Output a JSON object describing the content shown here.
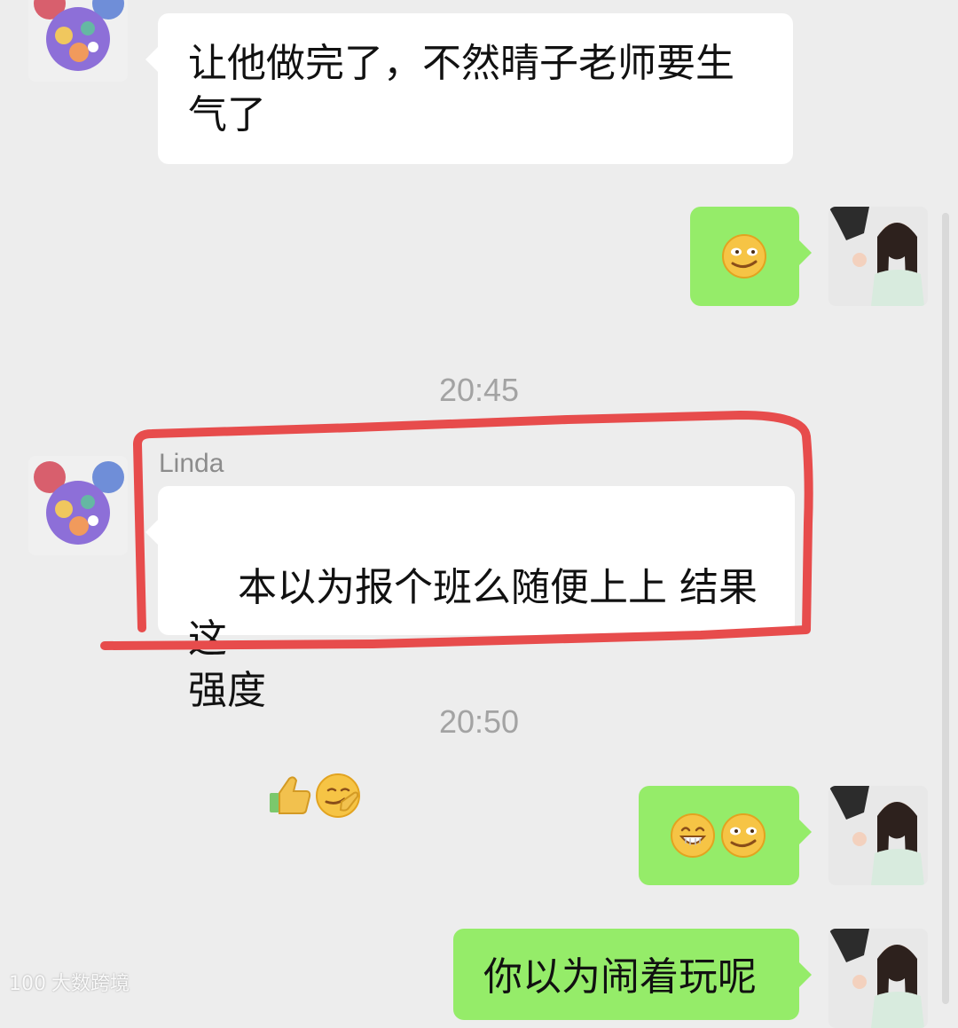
{
  "chat": {
    "messages": [
      {
        "sender": "",
        "text": "让他做完了，不然晴子老师要生\n气了"
      },
      {
        "sender": "me",
        "text": "",
        "emojis": [
          "smirk-emoji"
        ]
      },
      {
        "time": "20:45"
      },
      {
        "sender": "Linda",
        "text": "本以为报个班么随便上上 结果这\n强度",
        "emojis": [
          "thumbs-up-emoji",
          "facepalm-emoji"
        ]
      },
      {
        "time": "20:50"
      },
      {
        "sender": "me",
        "text": "",
        "emojis": [
          "grin-emoji",
          "smirk-emoji"
        ]
      },
      {
        "sender": "me",
        "text": "你以为闹着玩呢"
      }
    ]
  },
  "watermark": {
    "text": "大数跨境",
    "logo_text": "100"
  },
  "colors": {
    "background": "#ededed",
    "incoming_bubble": "#ffffff",
    "outgoing_bubble": "#95ec69",
    "annotation_stroke": "#e74c4c",
    "timestamp": "#a3a3a3"
  }
}
